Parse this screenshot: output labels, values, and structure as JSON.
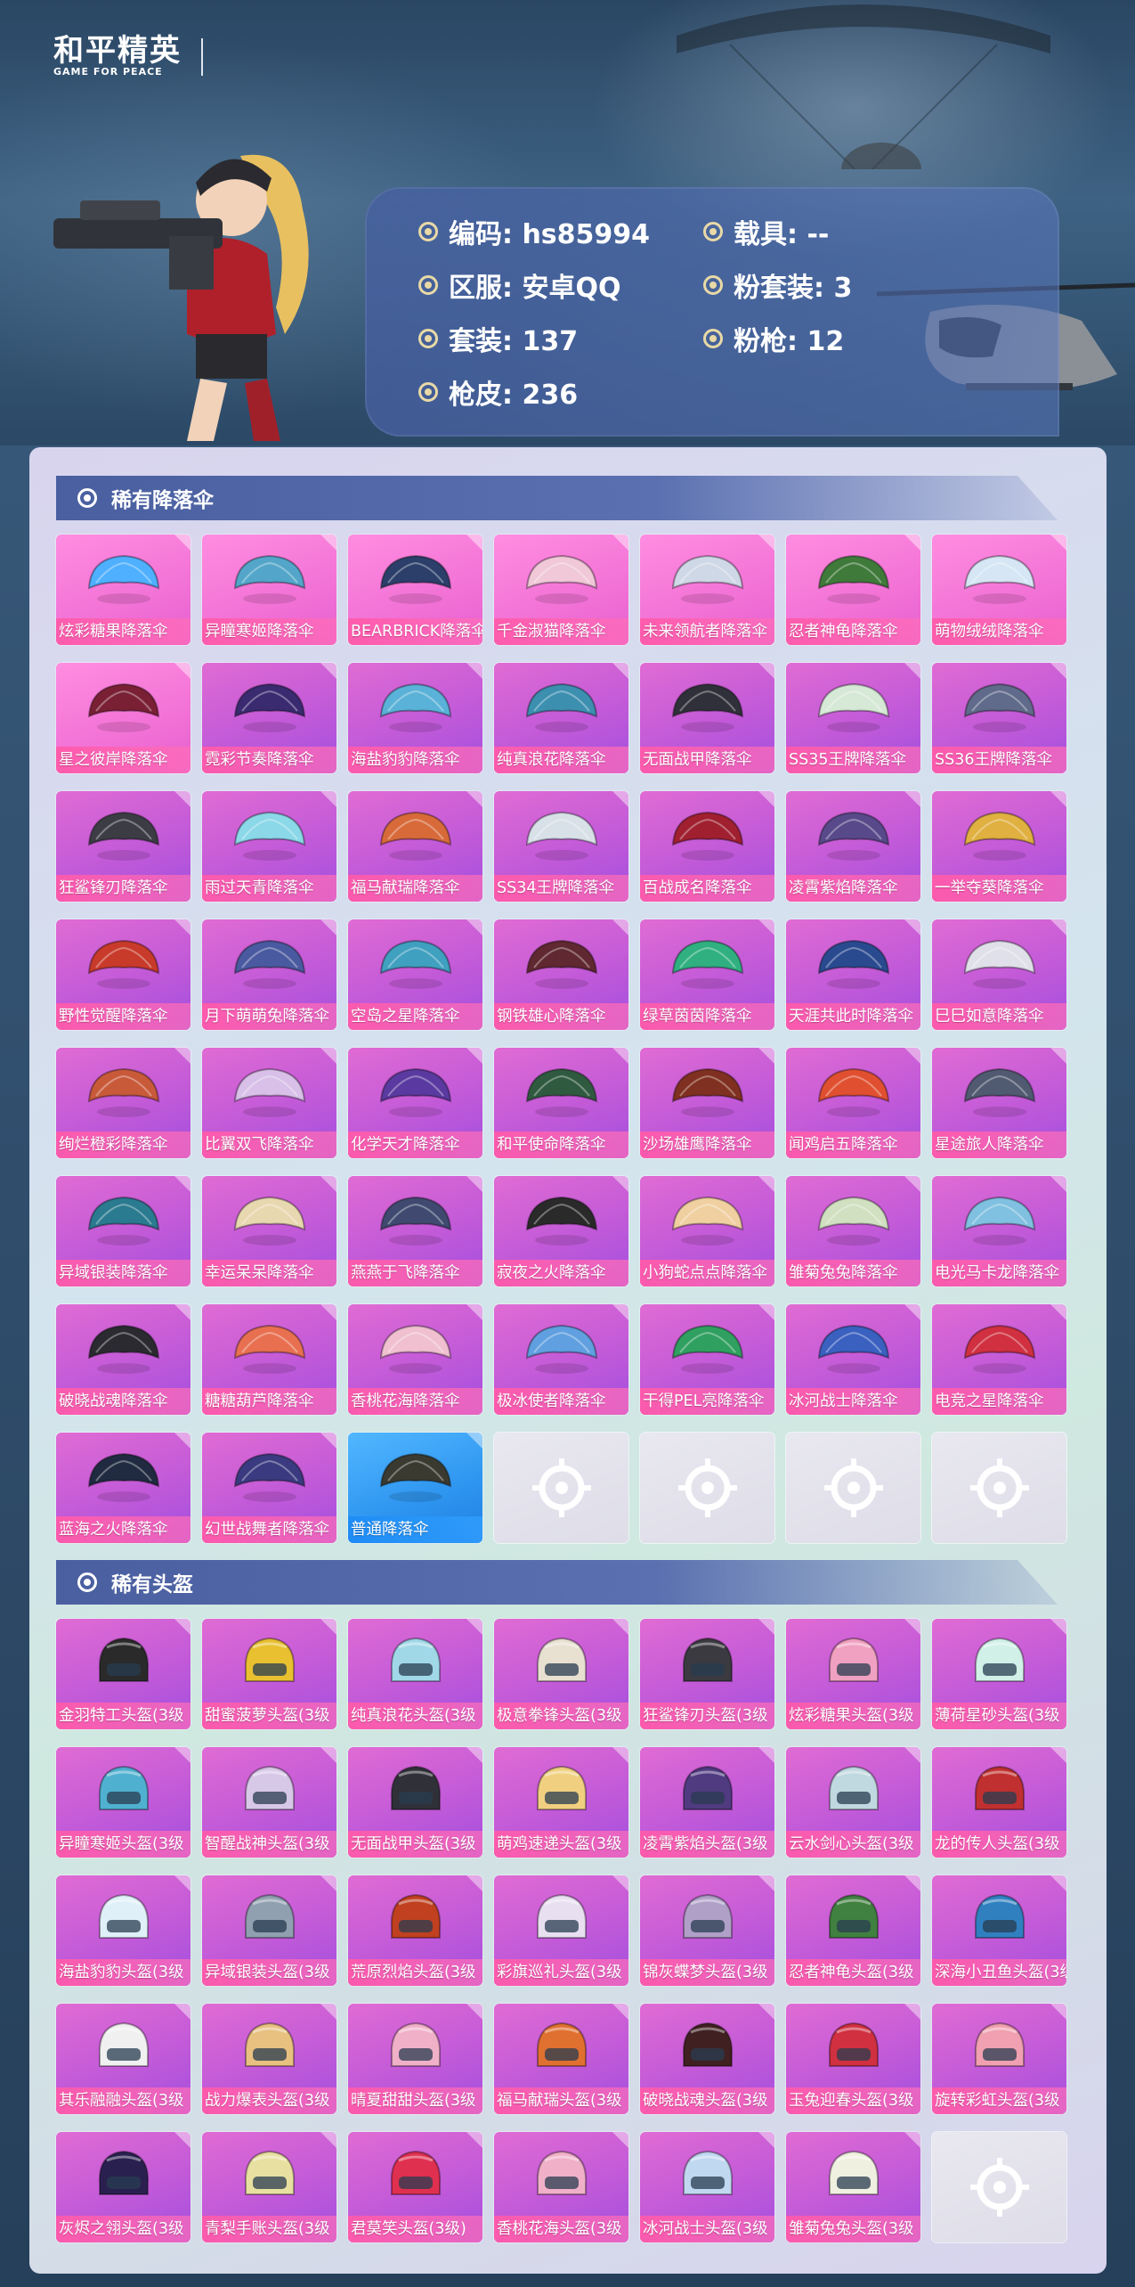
{
  "logo": {
    "title": "和平精英",
    "subtitle": "GAME FOR PEACE"
  },
  "info": {
    "code": "编码: hs85994",
    "server": "区服: 安卓QQ",
    "outfits": "套装: 137",
    "skins": "枪皮: 236",
    "vehicle": "载具: --",
    "pink_outfits": "粉套装: 3",
    "pink_guns": "粉枪: 12"
  },
  "parachutes": {
    "title": "稀有降落伞",
    "items": [
      {
        "label": "炫彩糖果降落伞",
        "style": "pink",
        "color": "#4fb0ff"
      },
      {
        "label": "异瞳寒姬降落伞",
        "style": "pink",
        "color": "#53a6c9"
      },
      {
        "label": "BEARBRICK降落伞",
        "style": "pink",
        "color": "#2c3f6a"
      },
      {
        "label": "千金淑猫降落伞",
        "style": "pink",
        "color": "#f0c8d8"
      },
      {
        "label": "未来领航者降落伞",
        "style": "pink",
        "color": "#cfd8e6"
      },
      {
        "label": "忍者神龟降落伞",
        "style": "pink",
        "color": "#3f7a3a"
      },
      {
        "label": "萌物绒绒降落伞",
        "style": "pink",
        "color": "#d6e6f5"
      },
      {
        "label": "星之彼岸降落伞",
        "style": "pink",
        "color": "#7a2034"
      },
      {
        "label": "霓彩节奏降落伞",
        "style": "purple",
        "color": "#3a2a70"
      },
      {
        "label": "海盐豹豹降落伞",
        "style": "purple",
        "color": "#5ab2d8"
      },
      {
        "label": "纯真浪花降落伞",
        "style": "purple",
        "color": "#3d8fb0"
      },
      {
        "label": "无面战甲降落伞",
        "style": "purple",
        "color": "#30303a"
      },
      {
        "label": "SS35王牌降落伞",
        "style": "purple",
        "color": "#d6e8d6"
      },
      {
        "label": "SS36王牌降落伞",
        "style": "purple",
        "color": "#606a8a"
      },
      {
        "label": "狂鲨锋刃降落伞",
        "style": "purple",
        "color": "#3c3c44"
      },
      {
        "label": "雨过天青降落伞",
        "style": "purple",
        "color": "#8ad8e8"
      },
      {
        "label": "福马献瑞降落伞",
        "style": "purple",
        "color": "#d86a3a"
      },
      {
        "label": "SS34王牌降落伞",
        "style": "purple",
        "color": "#d8e0e8"
      },
      {
        "label": "百战成名降落伞",
        "style": "purple",
        "color": "#a02030"
      },
      {
        "label": "凌霄紫焰降落伞",
        "style": "purple",
        "color": "#584a8a"
      },
      {
        "label": "一举夺葵降落伞",
        "style": "purple",
        "color": "#e0b040"
      },
      {
        "label": "野性觉醒降落伞",
        "style": "purple",
        "color": "#c83a2a"
      },
      {
        "label": "月下萌萌兔降落伞",
        "style": "purple",
        "color": "#4a5aa0"
      },
      {
        "label": "空岛之星降落伞",
        "style": "purple",
        "color": "#40a0c0"
      },
      {
        "label": "钢铁雄心降落伞",
        "style": "purple",
        "color": "#602830"
      },
      {
        "label": "绿草茵茵降落伞",
        "style": "purple",
        "color": "#30b080"
      },
      {
        "label": "天涯共此时降落伞",
        "style": "purple",
        "color": "#2a4a90"
      },
      {
        "label": "巳巳如意降落伞",
        "style": "purple",
        "color": "#e0e0ea"
      },
      {
        "label": "绚烂橙彩降落伞",
        "style": "purple",
        "color": "#c85a3a"
      },
      {
        "label": "比翼双飞降落伞",
        "style": "purple",
        "color": "#d8c0e8"
      },
      {
        "label": "化学天才降落伞",
        "style": "purple",
        "color": "#5a3aa0"
      },
      {
        "label": "和平使命降落伞",
        "style": "purple",
        "color": "#305a40"
      },
      {
        "label": "沙场雄鹰降落伞",
        "style": "purple",
        "color": "#803020"
      },
      {
        "label": "闻鸡启五降落伞",
        "style": "purple",
        "color": "#e05030"
      },
      {
        "label": "星途旅人降落伞",
        "style": "purple",
        "color": "#505a70"
      },
      {
        "label": "异域银装降落伞",
        "style": "purple",
        "color": "#2a7a90"
      },
      {
        "label": "幸运呆呆降落伞",
        "style": "purple",
        "color": "#e8d8b0"
      },
      {
        "label": "燕燕于飞降落伞",
        "style": "purple",
        "color": "#404a70"
      },
      {
        "label": "寂夜之火降落伞",
        "style": "purple",
        "color": "#2a2a2a"
      },
      {
        "label": "小狗蛇点点降落伞",
        "style": "purple",
        "color": "#f0d0a0"
      },
      {
        "label": "雏菊兔兔降落伞",
        "style": "purple",
        "color": "#d0e0c0"
      },
      {
        "label": "电光马卡龙降落伞",
        "style": "purple",
        "color": "#80c0e0"
      },
      {
        "label": "破晓战魂降落伞",
        "style": "purple",
        "color": "#2a2a30"
      },
      {
        "label": "糖糖葫芦降落伞",
        "style": "purple",
        "color": "#e87050"
      },
      {
        "label": "香桃花海降落伞",
        "style": "purple",
        "color": "#f0c0d0"
      },
      {
        "label": "极冰使者降落伞",
        "style": "purple",
        "color": "#60a0e0"
      },
      {
        "label": "干得PEL亮降落伞",
        "style": "purple",
        "color": "#30a060"
      },
      {
        "label": "冰河战士降落伞",
        "style": "purple",
        "color": "#3a60c0"
      },
      {
        "label": "电竞之星降落伞",
        "style": "purple",
        "color": "#d03040"
      },
      {
        "label": "蓝海之火降落伞",
        "style": "purple",
        "color": "#202a40"
      },
      {
        "label": "幻世战舞者降落伞",
        "style": "purple",
        "color": "#3a3a80"
      },
      {
        "label": "普通降落伞",
        "style": "blue",
        "color": "#3a3a30"
      }
    ],
    "empty_slots": 4
  },
  "helmets": {
    "title": "稀有头盔",
    "items": [
      {
        "label": "金羽特工头盔(3级",
        "style": "purple",
        "color": "#2a2a2a"
      },
      {
        "label": "甜蜜菠萝头盔(3级",
        "style": "purple",
        "color": "#e8c030"
      },
      {
        "label": "纯真浪花头盔(3级",
        "style": "purple",
        "color": "#a0d8e8"
      },
      {
        "label": "极意拳锋头盔(3级",
        "style": "purple",
        "color": "#e8e0d0"
      },
      {
        "label": "狂鲨锋刃头盔(3级",
        "style": "purple",
        "color": "#3a3a40"
      },
      {
        "label": "炫彩糖果头盔(3级",
        "style": "purple",
        "color": "#f0a0c0"
      },
      {
        "label": "薄荷星砂头盔(3级",
        "style": "purple",
        "color": "#d0f0e8"
      },
      {
        "label": "异瞳寒姬头盔(3级",
        "style": "purple",
        "color": "#50b0d0"
      },
      {
        "label": "智醒战神头盔(3级",
        "style": "purple",
        "color": "#d8c8e8"
      },
      {
        "label": "无面战甲头盔(3级",
        "style": "purple",
        "color": "#303038"
      },
      {
        "label": "萌鸡速递头盔(3级",
        "style": "purple",
        "color": "#f0d080"
      },
      {
        "label": "凌霄紫焰头盔(3级",
        "style": "purple",
        "color": "#503a80"
      },
      {
        "label": "云水剑心头盔(3级",
        "style": "purple",
        "color": "#c0d8e0"
      },
      {
        "label": "龙的传人头盔(3级",
        "style": "purple",
        "color": "#c03030"
      },
      {
        "label": "海盐豹豹头盔(3级",
        "style": "purple",
        "color": "#e0f0f8"
      },
      {
        "label": "异域银装头盔(3级",
        "style": "purple",
        "color": "#90a0b0"
      },
      {
        "label": "荒原烈焰头盔(3级",
        "style": "purple",
        "color": "#c04020"
      },
      {
        "label": "彩旗巡礼头盔(3级",
        "style": "purple",
        "color": "#e8e0f0"
      },
      {
        "label": "锦灰蝶梦头盔(3级",
        "style": "purple",
        "color": "#b0a0c8"
      },
      {
        "label": "忍者神龟头盔(3级",
        "style": "purple",
        "color": "#408040"
      },
      {
        "label": "深海小丑鱼头盔(3级",
        "style": "purple",
        "color": "#3080c0"
      },
      {
        "label": "其乐融融头盔(3级",
        "style": "purple",
        "color": "#f0f0f0"
      },
      {
        "label": "战力爆表头盔(3级",
        "style": "purple",
        "color": "#e8c080"
      },
      {
        "label": "晴夏甜甜头盔(3级",
        "style": "purple",
        "color": "#f0b0c8"
      },
      {
        "label": "福马献瑞头盔(3级",
        "style": "purple",
        "color": "#e07030"
      },
      {
        "label": "破晓战魂头盔(3级",
        "style": "purple",
        "color": "#402020"
      },
      {
        "label": "玉兔迎春头盔(3级",
        "style": "purple",
        "color": "#d03040"
      },
      {
        "label": "旋转彩虹头盔(3级",
        "style": "purple",
        "color": "#f0a0b0"
      },
      {
        "label": "灰烬之翎头盔(3级",
        "style": "purple",
        "color": "#2a2050"
      },
      {
        "label": "青梨手账头盔(3级",
        "style": "purple",
        "color": "#e8e0a0"
      },
      {
        "label": "君莫笑头盔(3级)",
        "style": "purple",
        "color": "#e03050"
      },
      {
        "label": "香桃花海头盔(3级",
        "style": "purple",
        "color": "#f0b0c8"
      },
      {
        "label": "冰河战士头盔(3级",
        "style": "purple",
        "color": "#c0d8f0"
      },
      {
        "label": "雏菊兔兔头盔(3级",
        "style": "purple",
        "color": "#f0f0e0"
      }
    ],
    "empty_slots": 1
  }
}
